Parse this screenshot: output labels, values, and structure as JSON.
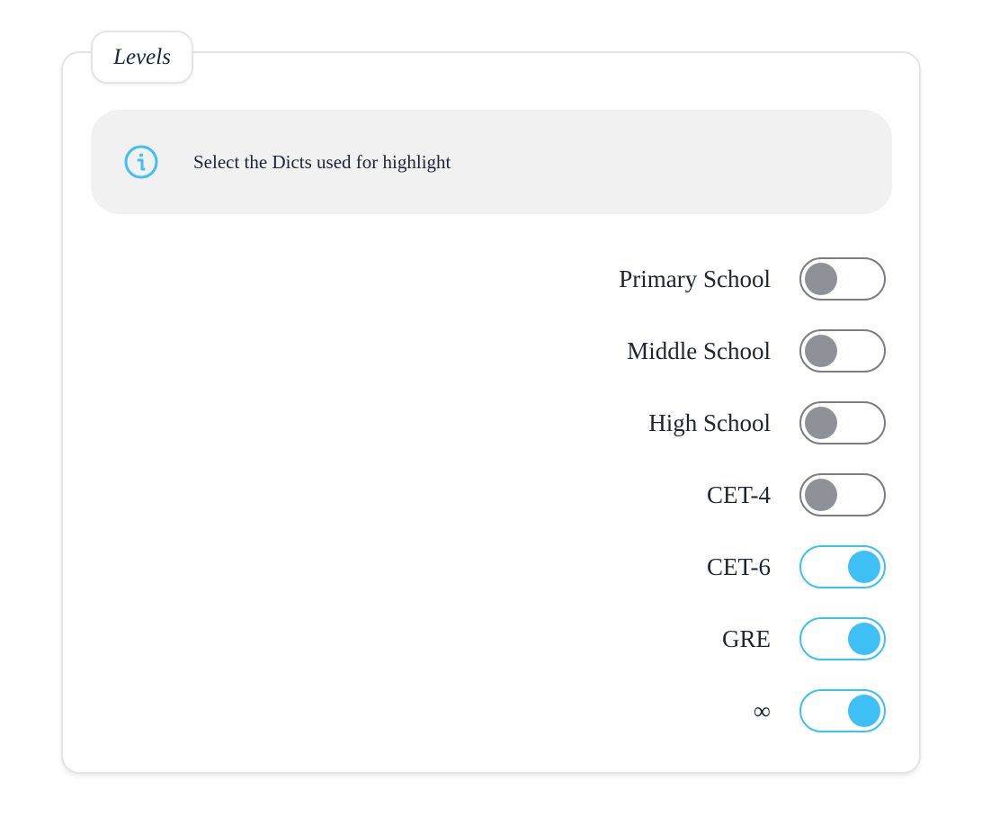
{
  "fieldset": {
    "legend": "Levels"
  },
  "info": {
    "icon": "info-icon",
    "text": "Select the Dicts used for highlight"
  },
  "colors": {
    "accent": "#3ec0f7",
    "off_knob": "#8e9198",
    "off_border": "#7b7e87"
  },
  "levels": [
    {
      "label": "Primary School",
      "on": false
    },
    {
      "label": "Middle School",
      "on": false
    },
    {
      "label": "High School",
      "on": false
    },
    {
      "label": "CET-4",
      "on": false
    },
    {
      "label": "CET-6",
      "on": true
    },
    {
      "label": "GRE",
      "on": true
    },
    {
      "label": "∞",
      "on": true
    }
  ]
}
